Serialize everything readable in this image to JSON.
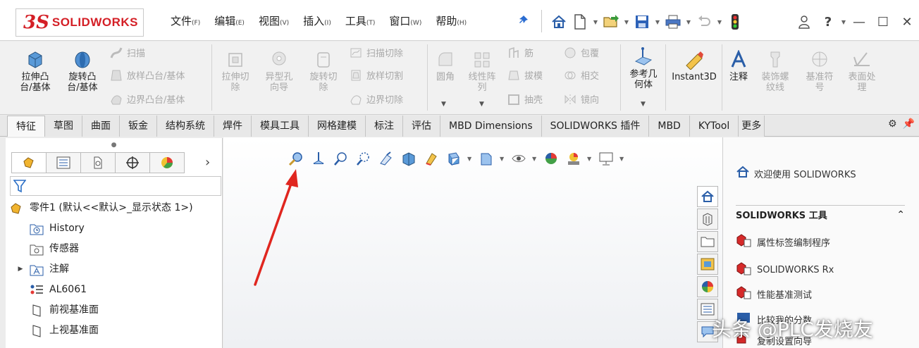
{
  "logo": {
    "mark": "3S",
    "name": "SOLIDWORKS"
  },
  "menu": [
    {
      "label": "文件",
      "key": "(F)"
    },
    {
      "label": "编辑",
      "key": "(E)"
    },
    {
      "label": "视图",
      "key": "(V)"
    },
    {
      "label": "插入",
      "key": "(I)"
    },
    {
      "label": "工具",
      "key": "(T)"
    },
    {
      "label": "窗口",
      "key": "(W)"
    },
    {
      "label": "帮助",
      "key": "(H)"
    }
  ],
  "ribbon": {
    "extrude_boss": "拉伸凸\n台/基体",
    "revolve_boss": "旋转凸\n台/基体",
    "sweep": "扫描",
    "loft": "放样凸台/基体",
    "boundary_boss": "边界凸台/基体",
    "extrude_cut": "拉伸切\n除",
    "hole_wizard": "异型孔\n向导",
    "revolve_cut": "旋转切\n除",
    "swept_cut": "扫描切除",
    "lofted_cut": "放样切割",
    "boundary_cut": "边界切除",
    "fillet": "圆角",
    "linear_pattern": "线性阵\n列",
    "rib": "筋",
    "draft": "拔模",
    "shell": "抽壳",
    "wrap": "包覆",
    "intersect": "相交",
    "mirror": "镜向",
    "ref_geometry": "参考几\n何体",
    "instant3d": "Instant3D",
    "annotation": "注释",
    "thread": "装饰螺\n纹线",
    "datum": "基准符\n号",
    "surface_finish": "表面处\n理"
  },
  "tabs": [
    "特征",
    "草图",
    "曲面",
    "钣金",
    "结构系统",
    "焊件",
    "模具工具",
    "网格建模",
    "标注",
    "评估",
    "MBD Dimensions",
    "SOLIDWORKS 插件",
    "MBD",
    "KYTool",
    "更多"
  ],
  "tree": {
    "root": "零件1 (默认<<默认>_显示状态 1>)",
    "items": [
      {
        "label": "History",
        "icon": "history-icon",
        "expandable": false
      },
      {
        "label": "传感器",
        "icon": "sensor-icon",
        "expandable": false
      },
      {
        "label": "注解",
        "icon": "annotation-icon",
        "expandable": true
      },
      {
        "label": "AL6061",
        "icon": "material-icon",
        "expandable": false
      },
      {
        "label": "前视基准面",
        "icon": "plane-icon",
        "expandable": false
      },
      {
        "label": "上视基准面",
        "icon": "plane-icon",
        "expandable": false
      }
    ]
  },
  "taskpane": {
    "welcome": "欢迎使用 SOLIDWORKS",
    "tools_header": "SOLIDWORKS 工具",
    "items": [
      "属性标签编制程序",
      "SOLIDWORKS Rx",
      "性能基准测试",
      "比较我的分数",
      "复制设置向导"
    ]
  },
  "watermark": "头条 @PLC发烧友",
  "colors": {
    "brand": "#d41f26",
    "arrow": "#e0261f",
    "accent": "#2a6cd1"
  }
}
